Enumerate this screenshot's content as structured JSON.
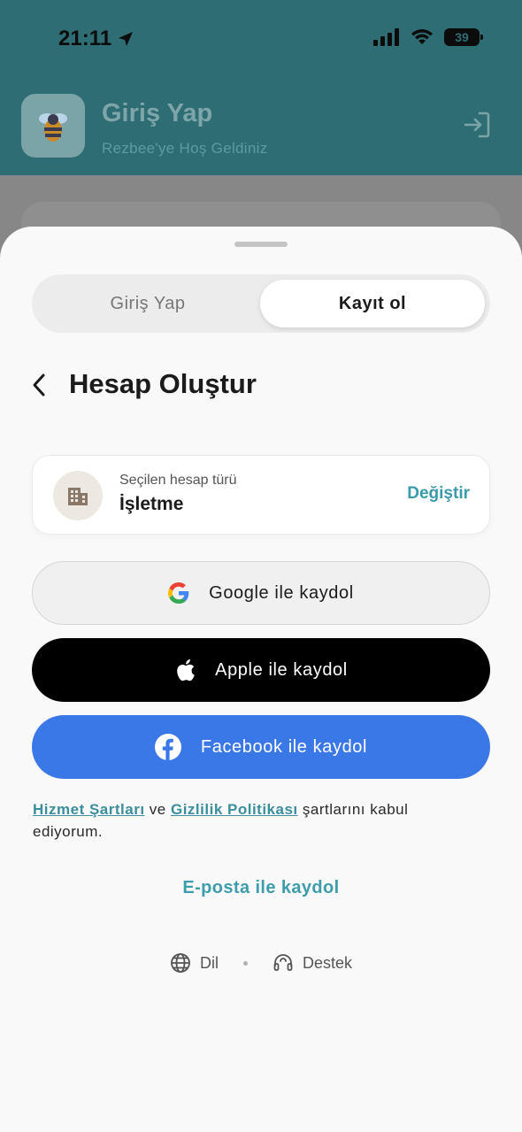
{
  "status_bar": {
    "time": "21:11",
    "battery": "39"
  },
  "header": {
    "title": "Giriş Yap",
    "subtitle": "Rezbee'ye Hoş Geldiniz"
  },
  "sheet": {
    "tabs": [
      {
        "label": "Giriş Yap",
        "active": false
      },
      {
        "label": "Kayıt ol",
        "active": true
      }
    ],
    "title": "Hesap Oluştur",
    "account_type": {
      "label": "Seçilen hesap türü",
      "value": "İşletme",
      "change_label": "Değiştir"
    },
    "buttons": {
      "google": "Google ile kaydol",
      "apple": "Apple ile kaydol",
      "facebook": "Facebook ile kaydol"
    },
    "terms": {
      "terms_link": "Hizmet Şartları",
      "and": "ve",
      "privacy_link": "Gizlilik Politikası",
      "suffix": "şartlarını kabul ediyorum."
    },
    "email_signup": "E-posta ile kaydol",
    "footer": {
      "language": "Dil",
      "support": "Destek"
    }
  },
  "colors": {
    "accent": "#3d9dab",
    "facebook": "#3b78e7",
    "apple": "#000000",
    "header_bg": "#2e6d74"
  },
  "icons": [
    "location-arrow-icon",
    "signal-icon",
    "wifi-icon",
    "battery-icon",
    "bee-logo-icon",
    "login-icon",
    "back-chevron-icon",
    "building-icon",
    "google-icon",
    "apple-icon",
    "facebook-icon",
    "globe-icon",
    "headset-icon"
  ]
}
